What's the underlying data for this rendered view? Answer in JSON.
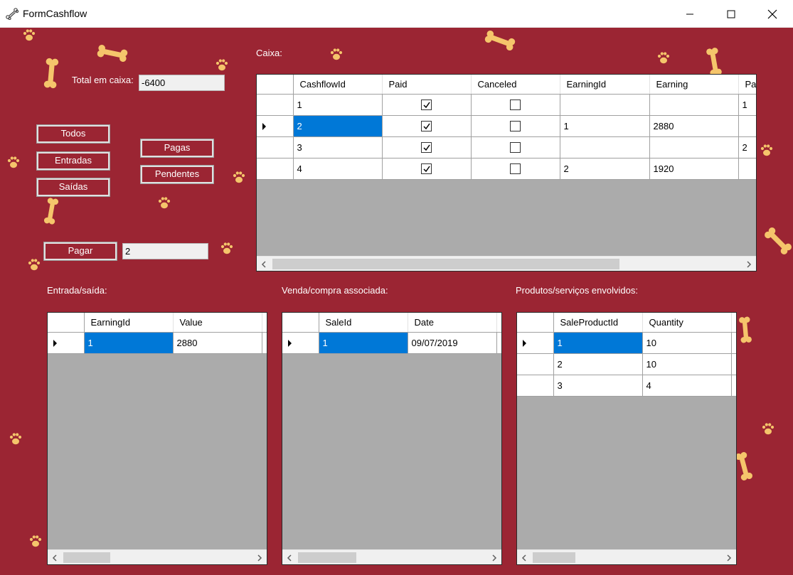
{
  "window": {
    "title": "FormCashflow"
  },
  "labels": {
    "total_caixa": "Total em caixa:",
    "caixa": "Caixa:",
    "entrada_saida": "Entrada/saída:",
    "venda_compra": "Venda/compra associada:",
    "produtos_servicos": "Produtos/serviços envolvidos:"
  },
  "fields": {
    "total_value": "-6400",
    "pagar_value": "2"
  },
  "buttons": {
    "todos": "Todos",
    "entradas": "Entradas",
    "saidas": "Saídas",
    "pagas": "Pagas",
    "pendentes": "Pendentes",
    "pagar": "Pagar"
  },
  "caixa_grid": {
    "columns": [
      "CashflowId",
      "Paid",
      "Canceled",
      "EarningId",
      "Earning",
      "Pa"
    ],
    "rows": [
      {
        "cashflowid": "1",
        "paid": true,
        "canceled": false,
        "earningid": "",
        "earning": "",
        "pa": "1"
      },
      {
        "cashflowid": "2",
        "paid": true,
        "canceled": false,
        "earningid": "1",
        "earning": "2880",
        "pa": ""
      },
      {
        "cashflowid": "3",
        "paid": true,
        "canceled": false,
        "earningid": "",
        "earning": "",
        "pa": "2"
      },
      {
        "cashflowid": "4",
        "paid": true,
        "canceled": false,
        "earningid": "2",
        "earning": "1920",
        "pa": ""
      }
    ]
  },
  "entrada_grid": {
    "columns": [
      "EarningId",
      "Value"
    ],
    "rows": [
      {
        "earningid": "1",
        "value": "2880"
      }
    ]
  },
  "venda_grid": {
    "columns": [
      "SaleId",
      "Date"
    ],
    "rows": [
      {
        "saleid": "1",
        "date": "09/07/2019"
      }
    ]
  },
  "produtos_grid": {
    "columns": [
      "SaleProductId",
      "Quantity"
    ],
    "rows": [
      {
        "saleproductid": "1",
        "quantity": "10"
      },
      {
        "saleproductid": "2",
        "quantity": "10"
      },
      {
        "saleproductid": "3",
        "quantity": "4"
      }
    ]
  },
  "colors": {
    "background": "#9b2533",
    "selection": "#0078d7",
    "decoration": "#f5c56b"
  }
}
